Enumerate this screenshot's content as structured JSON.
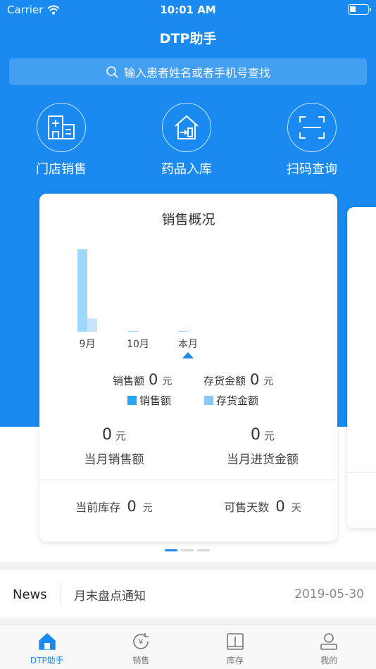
{
  "status_bar": {
    "carrier": "Carrier",
    "time": "10:01 AM"
  },
  "nav": {
    "title": "DTP助手"
  },
  "search": {
    "placeholder": "输入患者姓名或者手机号查找"
  },
  "quick_actions": [
    {
      "label": "门店销售",
      "icon": "store-icon"
    },
    {
      "label": "药品入库",
      "icon": "warehouse-inbound-icon"
    },
    {
      "label": "扫码查询",
      "icon": "scan-icon"
    }
  ],
  "sales_card": {
    "title": "销售概况",
    "sales_label": "销售额",
    "sales_value": "0",
    "sales_unit": "元",
    "stock_label": "存货金额",
    "stock_value": "0",
    "stock_unit": "元",
    "legend_sales": "销售额",
    "legend_stock": "存货金额",
    "month_sales_value": "0",
    "month_sales_unit": "元",
    "month_sales_label": "当月销售额",
    "month_purchase_value": "0",
    "month_purchase_unit": "元",
    "month_purchase_label": "当月进货金额",
    "inventory_label": "当前库存",
    "inventory_value": "0",
    "inventory_unit": "元",
    "days_label": "可售天数",
    "days_value": "0",
    "days_unit": "天"
  },
  "chart_data": {
    "type": "bar",
    "categories": [
      "9月",
      "10月",
      "本月"
    ],
    "series": [
      {
        "name": "销售额",
        "values": [
          100,
          1,
          1
        ]
      },
      {
        "name": "存货金额",
        "values": [
          16,
          0,
          0
        ]
      }
    ],
    "ylim": [
      0,
      100
    ],
    "selected_category": "本月",
    "grid": false,
    "colors": {
      "sales": "#9fd8ff",
      "stock": "#c6e4fb",
      "selected_marker": "#1a8af0"
    }
  },
  "pager": {
    "count": 3,
    "active": 0
  },
  "news": {
    "tag": "News",
    "title": "月末盘点通知",
    "date": "2019-05-30"
  },
  "tabs": [
    {
      "label": "DTP助手",
      "icon": "home-icon",
      "active": true
    },
    {
      "label": "销售",
      "icon": "yuan-refresh-icon",
      "active": false
    },
    {
      "label": "库存",
      "icon": "inventory-book-icon",
      "active": false
    },
    {
      "label": "我的",
      "icon": "profile-icon",
      "active": false
    }
  ],
  "colors": {
    "primary": "#1a8af0",
    "legend_sales": "#27a4f2",
    "legend_stock": "#8cc8f7"
  }
}
